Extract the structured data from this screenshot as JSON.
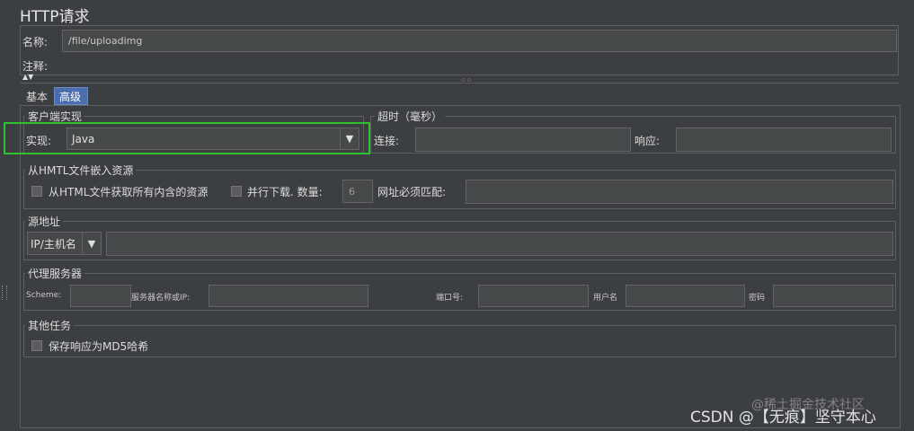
{
  "page": {
    "title": "HTTP请求"
  },
  "name_row": {
    "label": "名称:",
    "value": "/file/uploadimg"
  },
  "comment_row": {
    "label": "注释:"
  },
  "tabs": [
    {
      "label": "基本"
    },
    {
      "label": "高级"
    }
  ],
  "client_impl": {
    "legend": "客户端实现",
    "label": "实现:",
    "value": "Java"
  },
  "timeout": {
    "legend": "超时（毫秒）",
    "connect_label": "连接:",
    "response_label": "响应:"
  },
  "embedded": {
    "legend": "从HMTL文件嵌入资源",
    "fetch_label": "从HTML文件获取所有内含的资源",
    "parallel_label": "并行下载. 数量:",
    "parallel_value": "6",
    "url_match_label": "网址必须匹配:"
  },
  "source": {
    "legend": "源地址",
    "type_value": "IP/主机名"
  },
  "proxy": {
    "legend": "代理服务器",
    "scheme_label": "Scheme:",
    "host_label": "服务器名称或IP:",
    "port_label": "端口号:",
    "user_label": "用户名",
    "password_label": "密码"
  },
  "other": {
    "legend": "其他任务",
    "md5_label": "保存响应为MD5哈希"
  },
  "watermark": {
    "text1": "@稀土掘金技术社区",
    "text2": "CSDN @【无痕】坚守本心"
  }
}
